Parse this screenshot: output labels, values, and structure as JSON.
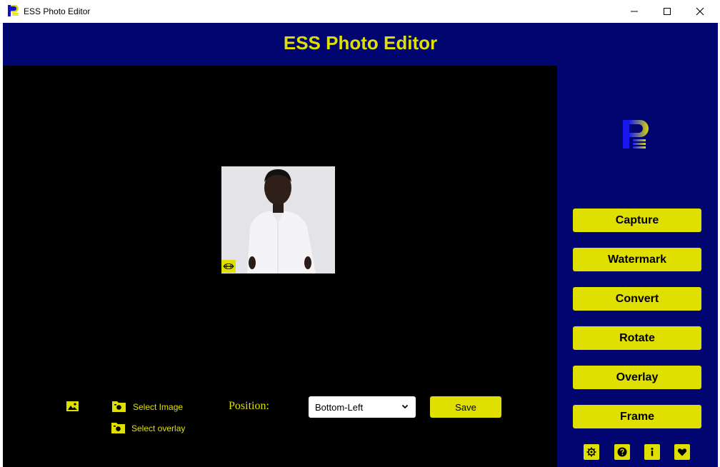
{
  "window": {
    "title": "ESS Photo Editor",
    "controls": [
      "minimize",
      "maximize",
      "close"
    ]
  },
  "header": {
    "title": "ESS Photo Editor"
  },
  "colors": {
    "accent": "#dfe000",
    "panel": "#000570",
    "canvas": "#000000"
  },
  "sidebar": {
    "buttons": [
      "Capture",
      "Watermark",
      "Convert",
      "Rotate",
      "Overlay",
      "Frame"
    ],
    "bottom_icons": [
      "settings-icon",
      "help-icon",
      "info-icon",
      "heart-icon"
    ]
  },
  "controls": {
    "image_icon": "image-icon",
    "select_image_label": "Select Image",
    "select_overlay_label": "Select overlay",
    "position_label": "Position:",
    "position_value": "Bottom-Left",
    "save_label": "Save"
  }
}
